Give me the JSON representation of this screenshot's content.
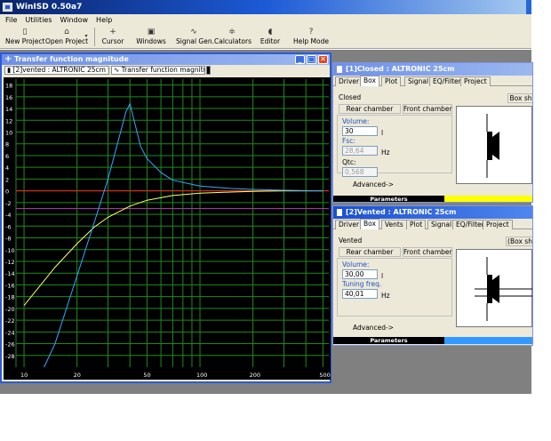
{
  "app": {
    "title": "WinISD 0.50a7"
  },
  "menu": [
    "File",
    "Utilities",
    "Window",
    "Help"
  ],
  "toolbar": [
    {
      "label": "New Project",
      "icon": "new-project-icon"
    },
    {
      "label": "Open Project",
      "icon": "open-folder-icon"
    },
    {
      "label": "Cursor",
      "icon": "cursor-icon"
    },
    {
      "label": "Windows",
      "icon": "windows-icon"
    },
    {
      "label": "Signal Gen.",
      "icon": "signal-gen-icon"
    },
    {
      "label": "Calculators",
      "icon": "calculators-icon"
    },
    {
      "label": "Editor",
      "icon": "editor-icon"
    },
    {
      "label": "Help Mode",
      "icon": "help-icon"
    }
  ],
  "transfer_window": {
    "title": "Transfer function magnitude",
    "project_select": "[2]vented : ALTRONIC 25cm",
    "graph_select": "Transfer function magnitude"
  },
  "closed_window": {
    "title": "[1]Closed : ALTRONIC 25cm",
    "tabs": [
      "Driver",
      "Box",
      "Plot",
      "Signal",
      "EQ/Filter",
      "Project"
    ],
    "active_tab": "Box",
    "box_type": "Closed",
    "box_shape_button": "Box sh",
    "rear_chamber": "Rear chamber",
    "front_chamber": "Front chamber",
    "volume_label": "Volume:",
    "volume_value": "30",
    "volume_unit": "l",
    "fsc_label": "Fsc:",
    "fsc_value": "28,64",
    "fsc_unit": "Hz",
    "qtc_label": "Qtc:",
    "qtc_value": "0,568",
    "advanced": "Advanced->",
    "params": "Parameters",
    "params_color": "#ffff00"
  },
  "vented_window": {
    "title": "[2]Vented : ALTRONIC 25cm",
    "tabs": [
      "Driver",
      "Box",
      "Vents",
      "Plot",
      "Signal",
      "EQ/Filter",
      "Project"
    ],
    "active_tab": "Box",
    "box_type": "Vented",
    "box_shape_button": "(Box sh",
    "rear_chamber": "Rear chamber",
    "front_chamber": "Front chamber",
    "volume_label": "Volume:",
    "volume_value": "30,00",
    "volume_unit": "l",
    "tuning_label": "Tuning freq.",
    "tuning_value": "40,01",
    "tuning_unit": "Hz",
    "advanced": "Advanced->",
    "params": "Parameters",
    "params_color": "#3399ff"
  },
  "chart_data": {
    "type": "line",
    "xscale": "log",
    "xlim": [
      9,
      540
    ],
    "ylim": [
      -30,
      19
    ],
    "x_ticks": [
      10,
      20,
      50,
      100,
      200,
      500
    ],
    "y_ticks": [
      18,
      16,
      14,
      12,
      10,
      8,
      6,
      4,
      2,
      0,
      -2,
      -4,
      -6,
      -8,
      -10,
      -12,
      -14,
      -16,
      -18,
      -20,
      -22,
      -24,
      -26,
      -28
    ],
    "grid": true,
    "series": [
      {
        "color": "#ffff66",
        "x": [
          10,
          15,
          20,
          25,
          30,
          40,
          50,
          70,
          100,
          150,
          200,
          300,
          500
        ],
        "y": [
          -19.5,
          -13,
          -9,
          -6.2,
          -4.5,
          -2.6,
          -1.6,
          -0.8,
          -0.4,
          -0.2,
          -0.1,
          0,
          0
        ]
      },
      {
        "color": "#33aaff",
        "x": [
          13,
          15,
          20,
          25,
          30,
          35,
          38,
          40,
          43,
          46,
          50,
          60,
          70,
          100,
          150,
          200,
          300,
          500
        ],
        "y": [
          -30,
          -26,
          -14.5,
          -5.5,
          2,
          9.5,
          13.5,
          14.8,
          11,
          7.5,
          5.5,
          3.1,
          1.8,
          0.8,
          0.4,
          0.25,
          0.1,
          0
        ]
      }
    ],
    "reference_lines": [
      {
        "y": 0,
        "color": "#ff2020"
      },
      {
        "y": -3,
        "color": "#b030b0"
      }
    ]
  }
}
